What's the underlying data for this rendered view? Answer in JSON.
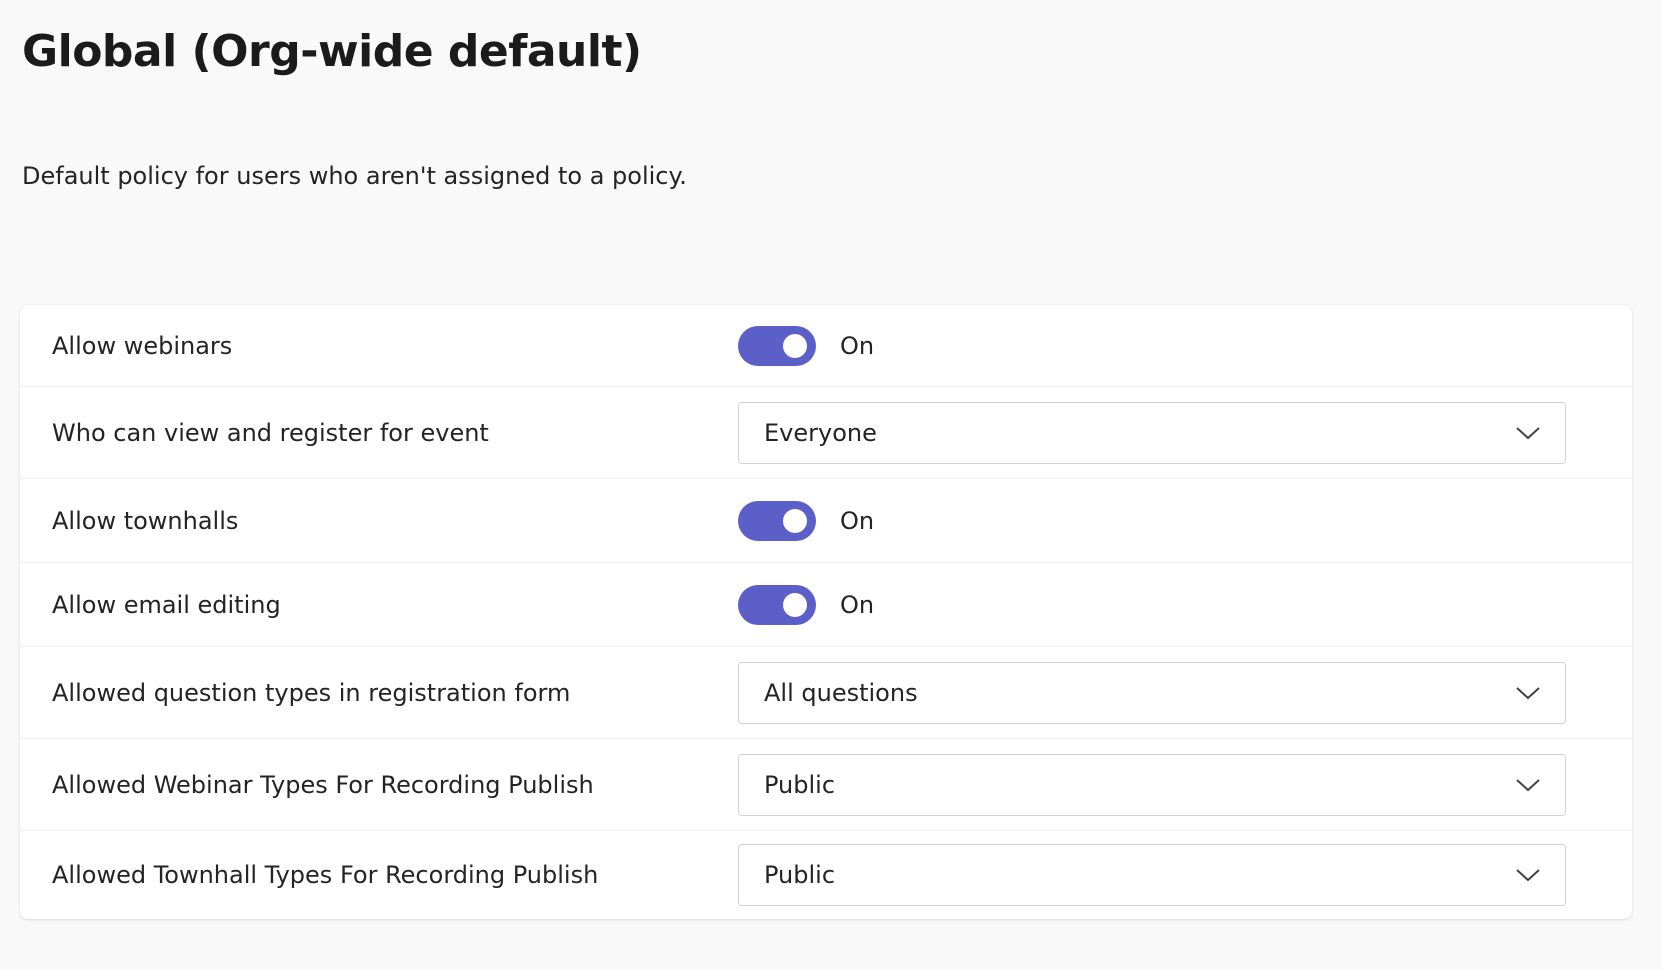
{
  "header": {
    "title": "Global (Org-wide default)",
    "description": "Default policy for users who aren't assigned to a policy."
  },
  "settings": [
    {
      "label": "Allow webinars",
      "type": "toggle",
      "on": true,
      "state_label": "On"
    },
    {
      "label": "Who can view and register for event",
      "type": "select",
      "value": "Everyone"
    },
    {
      "label": "Allow townhalls",
      "type": "toggle",
      "on": true,
      "state_label": "On"
    },
    {
      "label": "Allow email editing",
      "type": "toggle",
      "on": true,
      "state_label": "On"
    },
    {
      "label": "Allowed question types in registration form",
      "type": "select",
      "value": "All questions"
    },
    {
      "label": "Allowed Webinar Types For Recording Publish",
      "type": "select",
      "value": "Public"
    },
    {
      "label": "Allowed Townhall Types For Recording Publish",
      "type": "select",
      "value": "Public"
    }
  ],
  "colors": {
    "toggle_on": "#5b5fc7",
    "page_background": "#f9f9f9",
    "card_background": "#ffffff",
    "text": "#242424"
  },
  "icons": {
    "dropdown": "chevron-down-icon"
  }
}
